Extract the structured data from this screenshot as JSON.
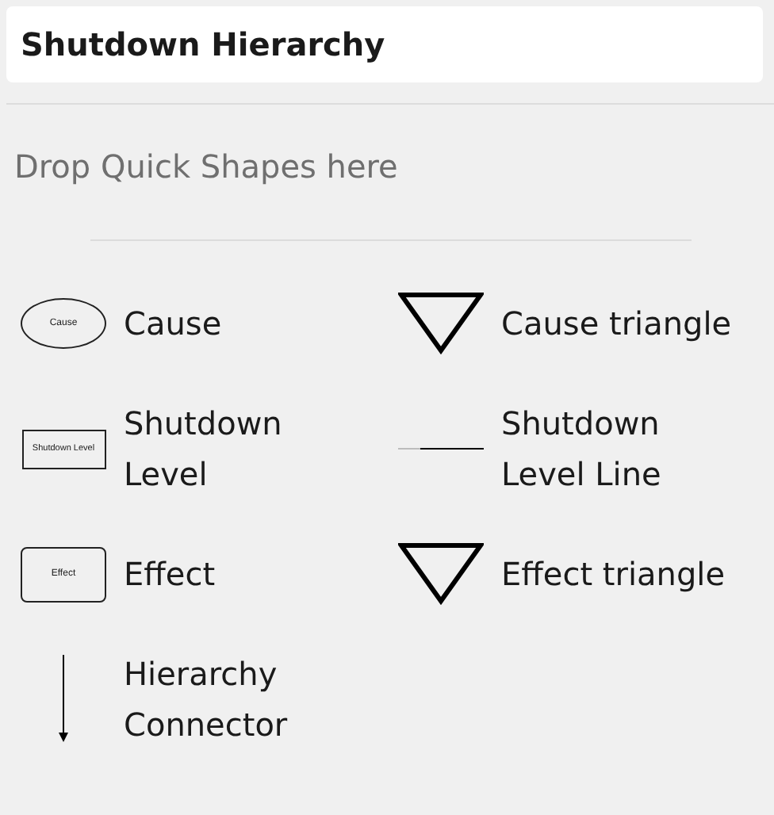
{
  "title": "Shutdown Hierarchy",
  "drop_hint": "Drop Quick Shapes here",
  "shapes": [
    {
      "label": "Cause",
      "kind": "ellipse",
      "icon_text": "Cause"
    },
    {
      "label": "Cause triangle",
      "kind": "triangle"
    },
    {
      "label": "Shutdown Level",
      "kind": "rectangle",
      "icon_text": "Shutdown Level"
    },
    {
      "label": "Shutdown Level Line",
      "kind": "line"
    },
    {
      "label": "Effect",
      "kind": "rounded",
      "icon_text": "Effect"
    },
    {
      "label": "Effect triangle",
      "kind": "triangle"
    },
    {
      "label": "Hierarchy Connector",
      "kind": "arrow"
    }
  ]
}
